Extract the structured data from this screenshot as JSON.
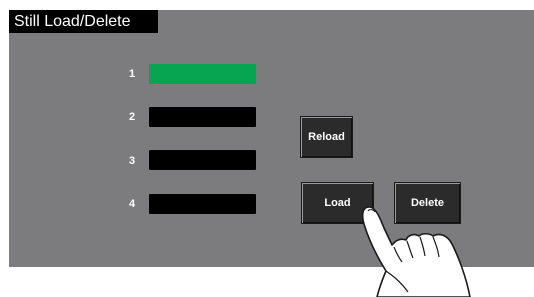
{
  "screen": {
    "title": "Still Load/Delete"
  },
  "slots": [
    {
      "number": "1",
      "selected": true
    },
    {
      "number": "2",
      "selected": false
    },
    {
      "number": "3",
      "selected": false
    },
    {
      "number": "4",
      "selected": false
    }
  ],
  "buttons": {
    "reload": "Reload",
    "load": "Load",
    "delete": "Delete"
  },
  "colors": {
    "panel": "#7c7c7e",
    "selected_slot": "#07a552",
    "empty_slot": "#000000"
  },
  "icons": {
    "pointer": "finger-pointer-icon"
  }
}
